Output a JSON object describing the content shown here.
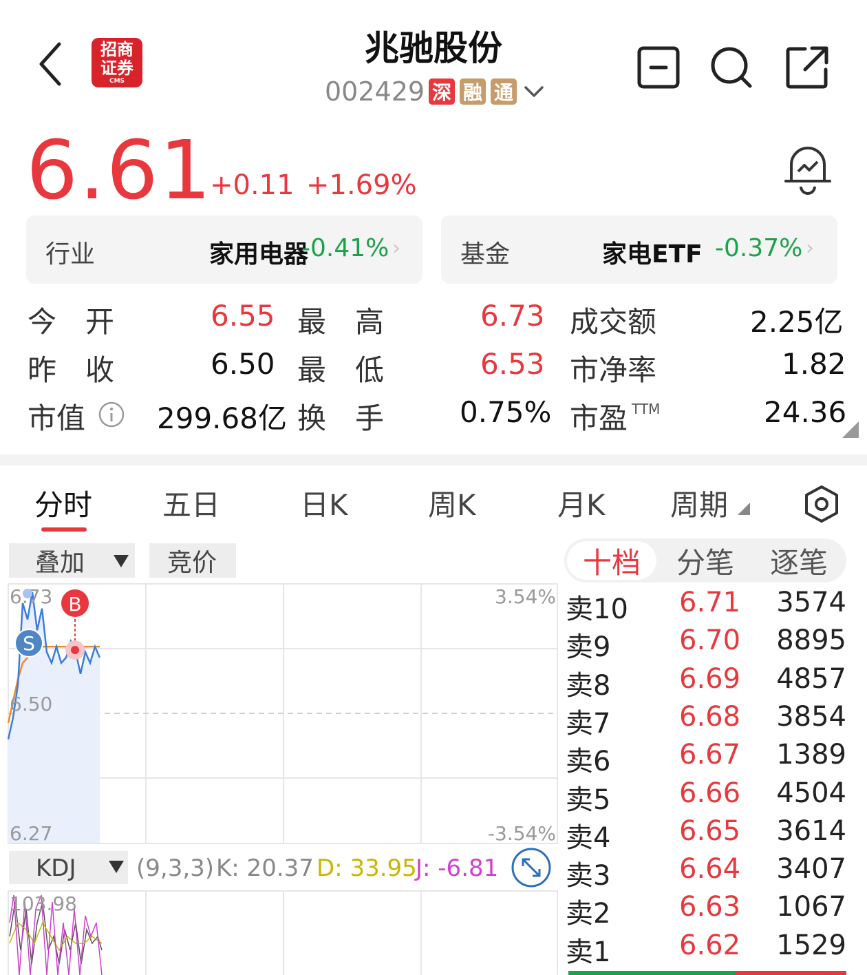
{
  "header": {
    "stock_name": "兆驰股份",
    "stock_code": "002429",
    "tags": [
      "深",
      "融",
      "通"
    ],
    "logo": {
      "line1": "招商",
      "line2": "证券",
      "line3": "CMS"
    }
  },
  "quote": {
    "price": "6.61",
    "change": "+0.11",
    "change_pct": "+1.69%"
  },
  "industry_card": {
    "label": "行业",
    "name": "家用电器",
    "change": "-0.41%"
  },
  "fund_card": {
    "label": "基金",
    "name": "家电ETF",
    "change": "-0.37%"
  },
  "stats": {
    "open_label": "今　开",
    "open": "6.55",
    "high_label": "最　高",
    "high": "6.73",
    "turnover_amt_label": "成交额",
    "turnover_amt": "2.25亿",
    "prev_close_label": "昨　收",
    "prev_close": "6.50",
    "low_label": "最　低",
    "low": "6.53",
    "pb_label": "市净率",
    "pb": "1.82",
    "mktcap_label": "市值",
    "mktcap": "299.68亿",
    "turnover_rate_label": "换　手",
    "turnover_rate": "0.75%",
    "pe_label": "市盈",
    "pe_sup": "TTM",
    "pe": "24.36"
  },
  "tabs": [
    "分时",
    "五日",
    "日K",
    "周K",
    "月K",
    "周期"
  ],
  "active_tab": "分时",
  "toolbar": {
    "overlay": "叠加",
    "auction": "竞价"
  },
  "chart": {
    "price_high": "6.73",
    "price_mid": "6.50",
    "price_low": "6.27",
    "pct_high": "3.54%",
    "pct_low": "-3.54%",
    "marker_buy": "B",
    "marker_sell": "S"
  },
  "kdj": {
    "name": "KDJ",
    "params": "(9,3,3)",
    "k": "K: 20.37",
    "d": "D: 33.95",
    "j": "J: -6.81",
    "top_value": "103.98"
  },
  "order_book": {
    "tabs": [
      "十档",
      "分笔",
      "逐笔"
    ],
    "active": "十档",
    "asks": [
      {
        "label": "卖10",
        "price": "6.71",
        "vol": "3574"
      },
      {
        "label": "卖9",
        "price": "6.70",
        "vol": "8895"
      },
      {
        "label": "卖8",
        "price": "6.69",
        "vol": "4857"
      },
      {
        "label": "卖7",
        "price": "6.68",
        "vol": "3854"
      },
      {
        "label": "卖6",
        "price": "6.67",
        "vol": "1389"
      },
      {
        "label": "卖5",
        "price": "6.66",
        "vol": "4504"
      },
      {
        "label": "卖4",
        "price": "6.65",
        "vol": "3614"
      },
      {
        "label": "卖3",
        "price": "6.64",
        "vol": "3407"
      },
      {
        "label": "卖2",
        "price": "6.63",
        "vol": "1067"
      },
      {
        "label": "卖1",
        "price": "6.62",
        "vol": "1529"
      }
    ]
  },
  "colors": {
    "up": "#e8383d",
    "down": "#1aa34a",
    "price_line": "#3b7ddd",
    "avg_line": "#f08a24"
  },
  "chart_data": {
    "type": "line",
    "series": [
      {
        "name": "price",
        "values": [
          6.46,
          6.5,
          6.56,
          6.71,
          6.68,
          6.73,
          6.66,
          6.7,
          6.62,
          6.6,
          6.63,
          6.6,
          6.61,
          6.64,
          6.62,
          6.58,
          6.62,
          6.6,
          6.63,
          6.61
        ]
      },
      {
        "name": "avg",
        "values": [
          6.49,
          6.53,
          6.57,
          6.6,
          6.61,
          6.62,
          6.62,
          6.63,
          6.63,
          6.63,
          6.63,
          6.63,
          6.63,
          6.63,
          6.63,
          6.63,
          6.63,
          6.63,
          6.63,
          6.63
        ]
      }
    ],
    "ylim": [
      6.27,
      6.73
    ],
    "title": "",
    "xlabel": "",
    "ylabel": ""
  }
}
